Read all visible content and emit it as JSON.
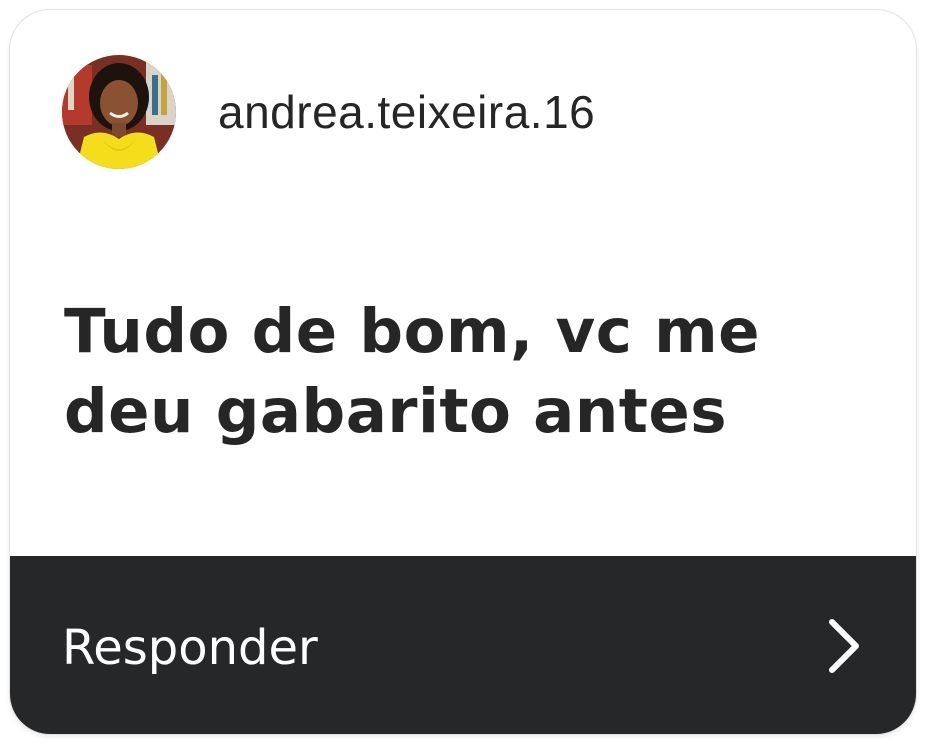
{
  "notification": {
    "username": "andrea.teixeira.16",
    "message": "Tudo de bom, vc me deu gabarito antes",
    "avatar_icon": "profile-photo",
    "reply_label": "Responder",
    "reply_icon": "chevron-right-icon"
  },
  "colors": {
    "card_bg": "#ffffff",
    "reply_bar_bg": "#262729",
    "text": "#262626",
    "reply_text": "#ffffff"
  }
}
